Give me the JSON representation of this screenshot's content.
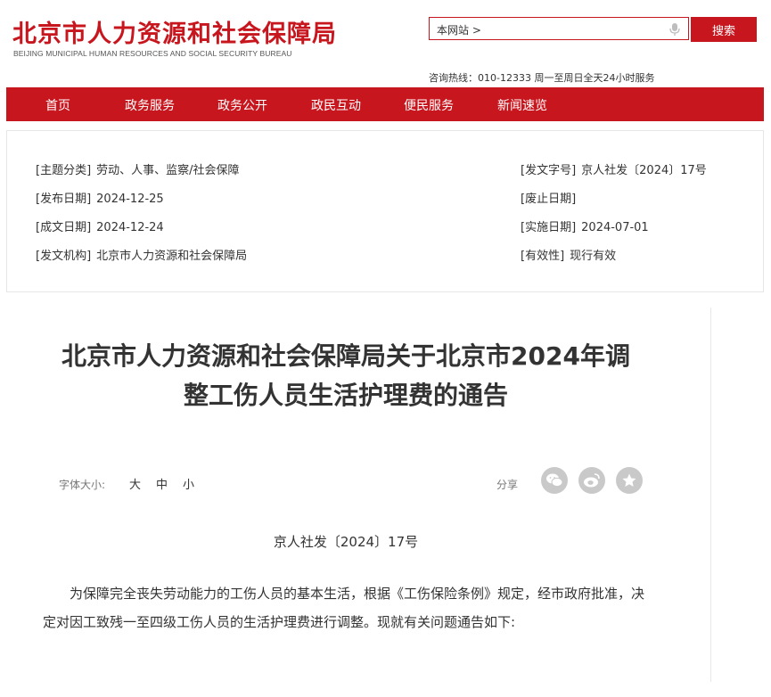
{
  "header": {
    "logo_cn": "北京市人力资源和社会保障局",
    "logo_en": "BEIJING MUNICIPAL HUMAN RESOURCES AND SOCIAL SECURITY BUREAU",
    "search_scope": "本网站 >",
    "search_button": "搜索",
    "hotline": "咨询热线：010-12333 周一至周日全天24小时服务"
  },
  "nav": {
    "items": [
      "首页",
      "政务服务",
      "政务公开",
      "政民互动",
      "便民服务",
      "新闻速览"
    ]
  },
  "meta": {
    "topic_label": "[主题分类]",
    "topic_value": "劳动、人事、监察/社会保障",
    "publish_label": "[发布日期]",
    "publish_value": "2024-12-25",
    "created_label": "[成文日期]",
    "created_value": "2024-12-24",
    "issuer_label": "[发文机构]",
    "issuer_value": "北京市人力资源和社会保障局",
    "docno_label": "[发文字号]",
    "docno_value": "京人社发〔2024〕17号",
    "expire_label": "[废止日期]",
    "expire_value": "",
    "effective_label": "[实施日期]",
    "effective_value": "2024-07-01",
    "validity_label": "[有效性]",
    "validity_value": "现行有效"
  },
  "article": {
    "title_line1": "北京市人力资源和社会保障局关于北京市2024年调",
    "title_line2": "整工伤人员生活护理费的通告",
    "font_size_label": "字体大小:",
    "font_large": "大",
    "font_medium": "中",
    "font_small": "小",
    "share_label": "分享",
    "share_icons": [
      "wechat-icon",
      "weibo-icon",
      "favorite-star-icon"
    ],
    "doc_number": "京人社发〔2024〕17号",
    "paragraph": "为保障完全丧失劳动能力的工伤人员的基本生活，根据《工伤保险条例》规定，经市政府批准，决定对因工致残一至四级工伤人员的生活护理费进行调整。现就有关问题通告如下:"
  },
  "colors": {
    "brand_red": "#c8161e",
    "icon_gray": "#c9c9c9"
  }
}
